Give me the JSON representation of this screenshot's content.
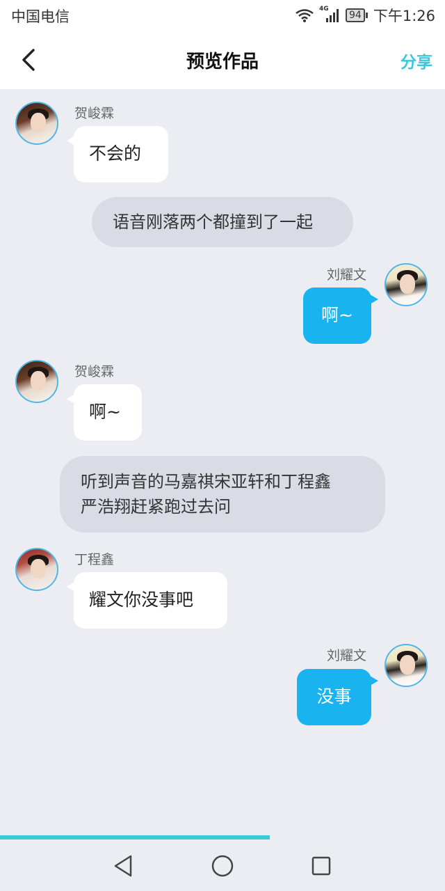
{
  "status_bar": {
    "carrier": "中国电信",
    "network": "4G",
    "battery": "94",
    "time": "下午1:26"
  },
  "header": {
    "title": "预览作品",
    "share_label": "分享",
    "accent_color": "#3ec6dc"
  },
  "messages": [
    {
      "type": "left",
      "name": "贺峻霖",
      "text": "不会的"
    },
    {
      "type": "narration",
      "text": "语音刚落两个都撞到了一起"
    },
    {
      "type": "right",
      "name": "刘耀文",
      "text": "啊~"
    },
    {
      "type": "left",
      "name": "贺峻霖",
      "text": "啊~"
    },
    {
      "type": "narration",
      "lines": [
        "听到声音的马嘉祺宋亚轩和丁程鑫",
        "严浩翔赶紧跑过去问"
      ]
    },
    {
      "type": "left",
      "name": "丁程鑫",
      "text": "耀文你没事吧"
    },
    {
      "type": "right",
      "name": "刘耀文",
      "text": "没事"
    }
  ],
  "colors": {
    "right_bubble": "#19b4f0",
    "left_bubble": "#ffffff",
    "narration_bubble": "#d9dce4",
    "background": "#ebedf2"
  },
  "playback_progress": 0.61,
  "icons": {
    "back": "back-arrow-icon",
    "nav_back": "nav-back-triangle-icon",
    "nav_home": "nav-home-circle-icon",
    "nav_recents": "nav-recents-square-icon"
  }
}
